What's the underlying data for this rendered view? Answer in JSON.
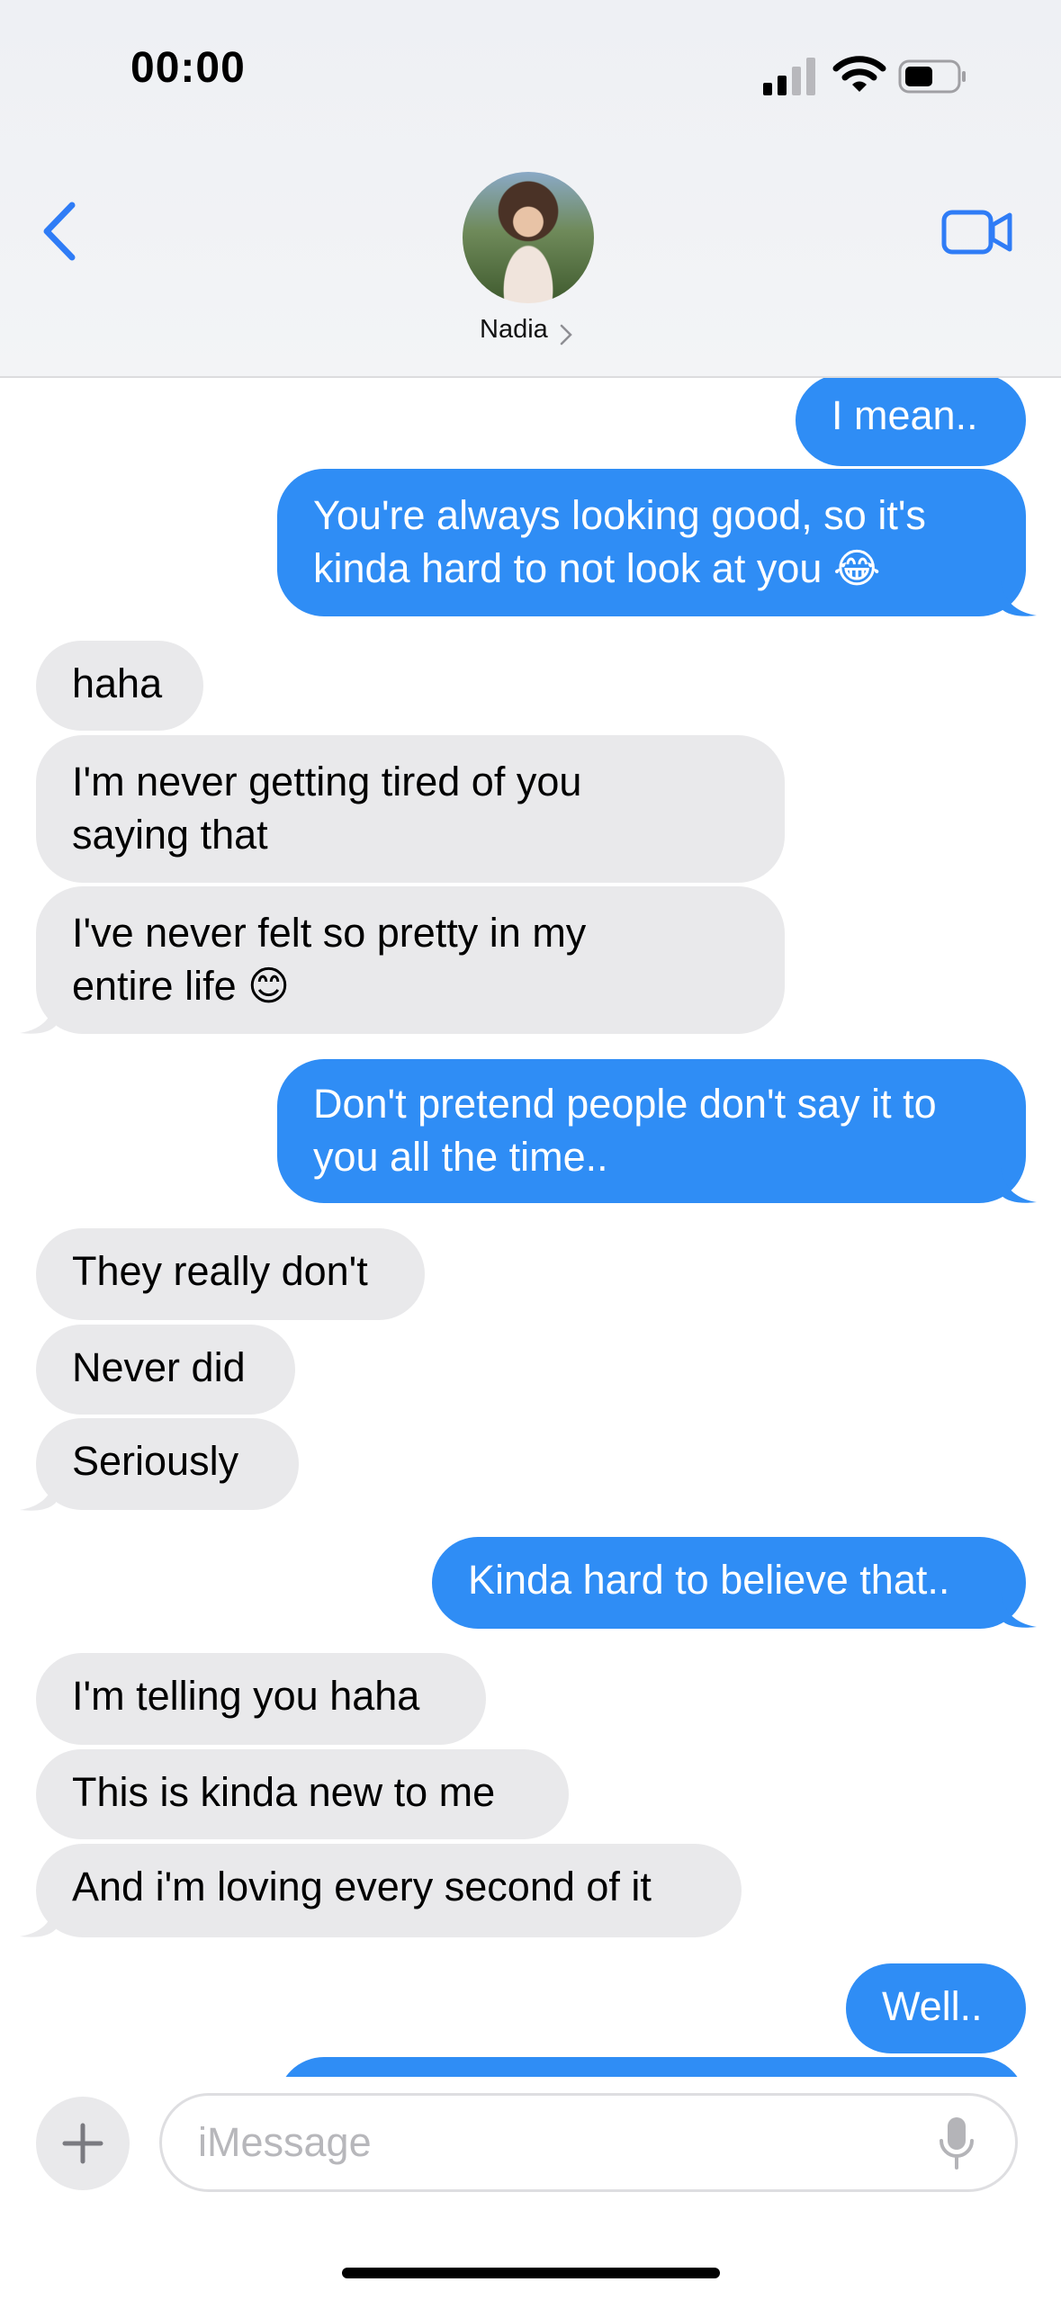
{
  "status_bar": {
    "time": "00:00"
  },
  "header": {
    "contact_name": "Nadia"
  },
  "messages": [
    {
      "from": "me",
      "text": "I mean.."
    },
    {
      "from": "me",
      "lines": [
        "You're always looking good, so it's",
        "kinda hard to not look at you 😂"
      ]
    },
    {
      "from": "them",
      "text": "haha"
    },
    {
      "from": "them",
      "lines": [
        "I'm never getting tired of you",
        "saying that"
      ]
    },
    {
      "from": "them",
      "lines": [
        "I've never felt so pretty in my",
        "entire life 😊"
      ]
    },
    {
      "from": "me",
      "lines": [
        "Don't pretend people don't say it to",
        "you all the time.."
      ]
    },
    {
      "from": "them",
      "text": "They really don't"
    },
    {
      "from": "them",
      "text": "Never did"
    },
    {
      "from": "them",
      "text": "Seriously"
    },
    {
      "from": "me",
      "text": "Kinda hard to believe that.."
    },
    {
      "from": "them",
      "text": "I'm telling you haha"
    },
    {
      "from": "them",
      "text": "This is kinda new to me"
    },
    {
      "from": "them",
      "text": "And i'm loving every second of it"
    },
    {
      "from": "me",
      "text": "Well.."
    }
  ],
  "composer": {
    "placeholder": "iMessage"
  },
  "colors": {
    "outgoing": "#2f8df5",
    "incoming": "#e9e9eb",
    "accent": "#2f7cf6"
  },
  "icons": {
    "back": "chevron-left-icon",
    "video": "video-camera-icon",
    "add": "plus-icon",
    "mic": "microphone-icon"
  }
}
